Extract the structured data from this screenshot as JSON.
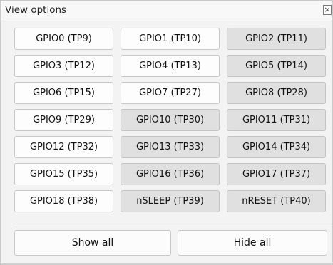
{
  "panel": {
    "title": "View options",
    "close_glyph": "×",
    "close_icon": "close-icon"
  },
  "buttons": [
    {
      "label": "GPIO0 (TP9)",
      "active": true
    },
    {
      "label": "GPIO1 (TP10)",
      "active": true
    },
    {
      "label": "GPIO2 (TP11)",
      "active": false
    },
    {
      "label": "GPIO3 (TP12)",
      "active": true
    },
    {
      "label": "GPIO4 (TP13)",
      "active": true
    },
    {
      "label": "GPIO5 (TP14)",
      "active": false
    },
    {
      "label": "GPIO6 (TP15)",
      "active": true
    },
    {
      "label": "GPIO7 (TP27)",
      "active": true
    },
    {
      "label": "GPIO8 (TP28)",
      "active": false
    },
    {
      "label": "GPIO9 (TP29)",
      "active": true
    },
    {
      "label": "GPIO10 (TP30)",
      "active": false
    },
    {
      "label": "GPIO11 (TP31)",
      "active": false
    },
    {
      "label": "GPIO12 (TP32)",
      "active": true
    },
    {
      "label": "GPIO13 (TP33)",
      "active": false
    },
    {
      "label": "GPIO14 (TP34)",
      "active": false
    },
    {
      "label": "GPIO15 (TP35)",
      "active": true
    },
    {
      "label": "GPIO16 (TP36)",
      "active": false
    },
    {
      "label": "GPIO17 (TP37)",
      "active": false
    },
    {
      "label": "GPIO18 (TP38)",
      "active": true
    },
    {
      "label": "nSLEEP (TP39)",
      "active": false
    },
    {
      "label": "nRESET (TP40)",
      "active": false
    }
  ],
  "actions": {
    "show_all": "Show all",
    "hide_all": "Hide all"
  }
}
